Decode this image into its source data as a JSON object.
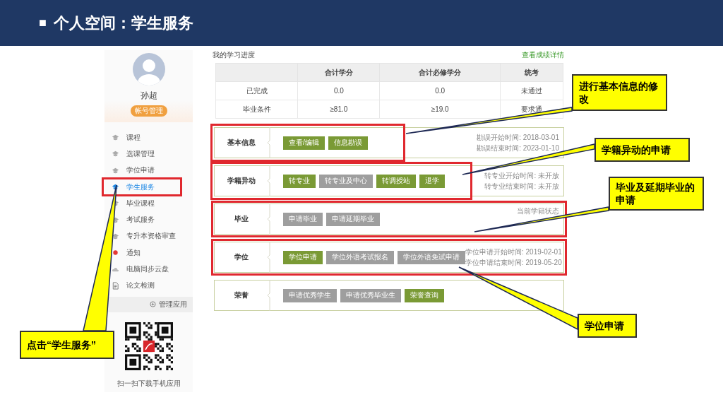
{
  "slide_title": {
    "bullet": "■",
    "text": "个人空间：学生服务"
  },
  "sidebar": {
    "user_name": "孙超",
    "account_button": "帐号管理",
    "items": [
      {
        "label": "课程",
        "kind": "cap",
        "selected": false,
        "highlighted": false
      },
      {
        "label": "选课管理",
        "kind": "cap",
        "selected": false,
        "highlighted": false
      },
      {
        "label": "学位申请",
        "kind": "cap",
        "selected": false,
        "highlighted": false
      },
      {
        "label": "学生服务",
        "kind": "cap",
        "selected": true,
        "highlighted": true
      },
      {
        "label": "毕业课程",
        "kind": "cap",
        "selected": false,
        "highlighted": false
      },
      {
        "label": "考试服务",
        "kind": "cap",
        "selected": false,
        "highlighted": false
      },
      {
        "label": "专升本资格审查",
        "kind": "cap",
        "selected": false,
        "highlighted": false
      },
      {
        "label": "通知",
        "kind": "dot",
        "selected": false,
        "highlighted": false
      },
      {
        "label": "电脑同步云盘",
        "kind": "cloud",
        "selected": false,
        "highlighted": false
      },
      {
        "label": "论文检测",
        "kind": "doc",
        "selected": false,
        "highlighted": false
      }
    ],
    "manage_apps": "管理应用",
    "qr_caption": "扫一扫下载手机应用"
  },
  "progress": {
    "title": "我的学习进度",
    "details_link": "查看成绩详情",
    "columns": [
      "合计学分",
      "合计必修学分",
      "统考"
    ],
    "rows": [
      {
        "label": "已完成",
        "cells": [
          "0.0",
          "0.0",
          "未通过"
        ]
      },
      {
        "label": "毕业条件",
        "cells": [
          "≥81.0",
          "≥19.0",
          "要求通"
        ]
      }
    ]
  },
  "sections": [
    {
      "label": "基本信息",
      "kind": "partial-frame",
      "buttons": [
        {
          "label": "查看/编辑",
          "enabled": true
        },
        {
          "label": "信息勘误",
          "enabled": true
        }
      ],
      "info": [
        "勘误开始时间: 2018-03-01",
        "勘误结束时间: 2023-01-10"
      ]
    },
    {
      "label": "学籍异动",
      "kind": "partial-frame",
      "buttons": [
        {
          "label": "转专业",
          "enabled": true
        },
        {
          "label": "转专业及中心",
          "enabled": false
        },
        {
          "label": "转调授站",
          "enabled": true
        },
        {
          "label": "退学",
          "enabled": true
        }
      ],
      "info": [
        "转专业开始时间: 未开放",
        "转专业结束时间: 未开放"
      ]
    },
    {
      "label": "毕业",
      "kind": "full-frame",
      "buttons": [
        {
          "label": "申请毕业",
          "enabled": false
        },
        {
          "label": "申请延期毕业",
          "enabled": false
        }
      ],
      "info": [
        "当前学籍状态"
      ]
    },
    {
      "label": "学位",
      "kind": "full-frame",
      "buttons": [
        {
          "label": "学位申请",
          "enabled": true
        },
        {
          "label": "学位外语考试报名",
          "enabled": false
        },
        {
          "label": "学位外语免试申请",
          "enabled": false
        }
      ],
      "info": [
        "学位申请开始时间: 2019-02-01",
        "学位申请结束时间: 2019-05-20"
      ]
    },
    {
      "label": "荣誉",
      "kind": "plain",
      "buttons": [
        {
          "label": "申请优秀学生",
          "enabled": false
        },
        {
          "label": "申请优秀毕业生",
          "enabled": false
        },
        {
          "label": "荣誉查询",
          "enabled": true
        }
      ]
    }
  ],
  "callouts": [
    "进行基本信息的修改",
    "学籍异动的申请",
    "毕业及延期毕业的申请",
    "学位申请",
    "点击“学生服务”"
  ]
}
